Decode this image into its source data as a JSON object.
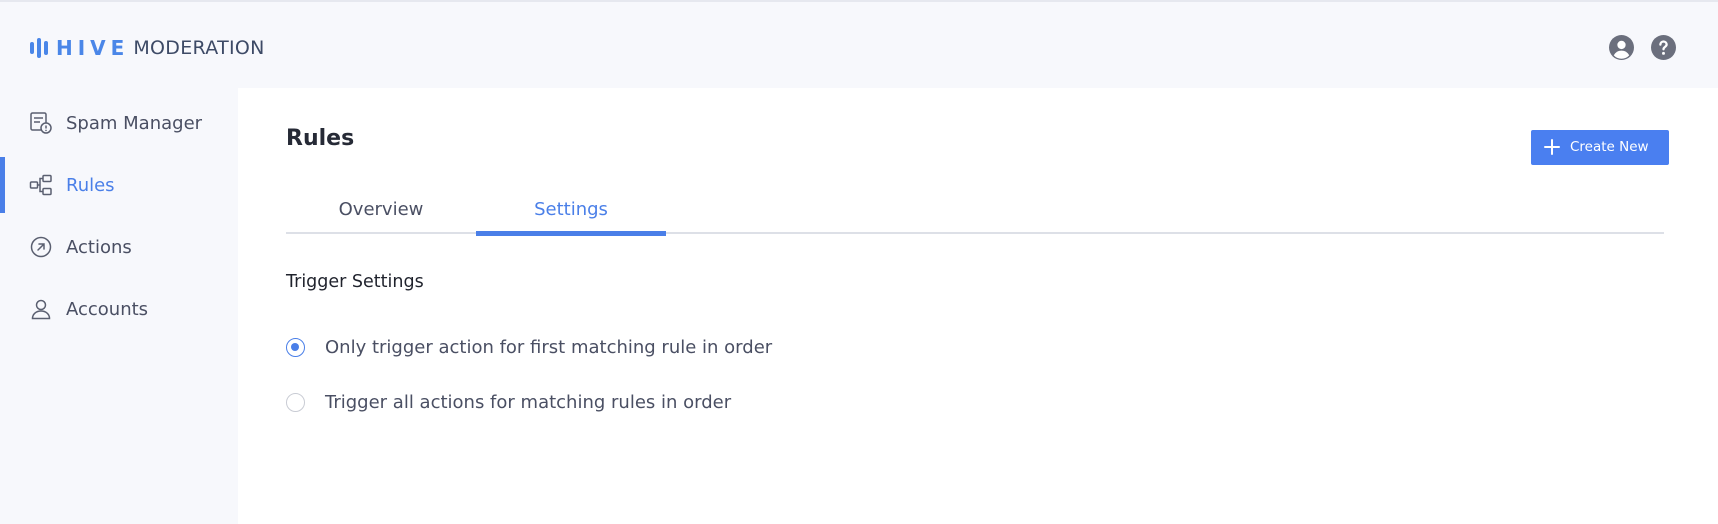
{
  "brand": {
    "name_part1": "HIVE",
    "name_part2": "MODERATION",
    "accent": "#4a86e8"
  },
  "header": {
    "icons": [
      "account-icon",
      "help-icon"
    ]
  },
  "sidebar": {
    "items": [
      {
        "label": "Spam Manager",
        "icon": "spam-manager-icon",
        "active": false
      },
      {
        "label": "Rules",
        "icon": "rules-icon",
        "active": true
      },
      {
        "label": "Actions",
        "icon": "actions-icon",
        "active": false
      },
      {
        "label": "Accounts",
        "icon": "accounts-icon",
        "active": false
      }
    ]
  },
  "main": {
    "title": "Rules",
    "create_button": {
      "label": "Create New",
      "icon": "plus-icon"
    },
    "tabs": [
      {
        "label": "Overview",
        "active": false
      },
      {
        "label": "Settings",
        "active": true
      }
    ],
    "trigger_settings": {
      "title": "Trigger Settings",
      "options": [
        {
          "label": "Only trigger action for first matching rule in order",
          "checked": true
        },
        {
          "label": "Trigger all actions for matching rules in order",
          "checked": false
        }
      ]
    }
  },
  "colors": {
    "primary": "#4a7fe8",
    "sidebar_bg": "#f7f8fc",
    "content_bg": "#ffffff"
  }
}
